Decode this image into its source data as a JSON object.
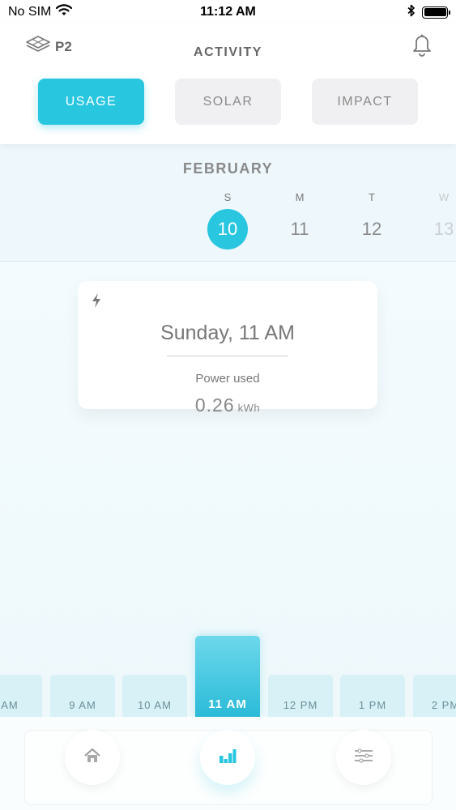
{
  "status_bar": {
    "carrier": "No SIM",
    "time": "11:12 AM"
  },
  "app": {
    "logo_text": "P2",
    "title": "ACTIVITY"
  },
  "tabs": [
    {
      "label": "USAGE",
      "active": true
    },
    {
      "label": "SOLAR",
      "active": false
    },
    {
      "label": "IMPACT",
      "active": false
    }
  ],
  "calendar": {
    "month": "FEBRUARY",
    "days": [
      {
        "letter": "S",
        "num": "10",
        "selected": true
      },
      {
        "letter": "M",
        "num": "11",
        "selected": false
      },
      {
        "letter": "T",
        "num": "12",
        "selected": false
      },
      {
        "letter": "W",
        "num": "13",
        "selected": false
      }
    ]
  },
  "info_card": {
    "datetime": "Sunday, 11 AM",
    "label": "Power used",
    "value": "0.26",
    "unit": "kWh"
  },
  "hours": [
    {
      "label": "AM",
      "selected": false
    },
    {
      "label": "9 AM",
      "selected": false
    },
    {
      "label": "10 AM",
      "selected": false
    },
    {
      "label": "11 AM",
      "selected": true
    },
    {
      "label": "12 PM",
      "selected": false
    },
    {
      "label": "1 PM",
      "selected": false
    },
    {
      "label": "2 PM",
      "selected": false
    }
  ],
  "nav": [
    {
      "icon": "home-icon",
      "active": false
    },
    {
      "icon": "bar-chart-icon",
      "active": true
    },
    {
      "icon": "settings-list-icon",
      "active": false
    }
  ],
  "colors": {
    "accent": "#29c6e0",
    "bar": "#d7f1f7",
    "tab_inactive": "#f0f0f2"
  }
}
